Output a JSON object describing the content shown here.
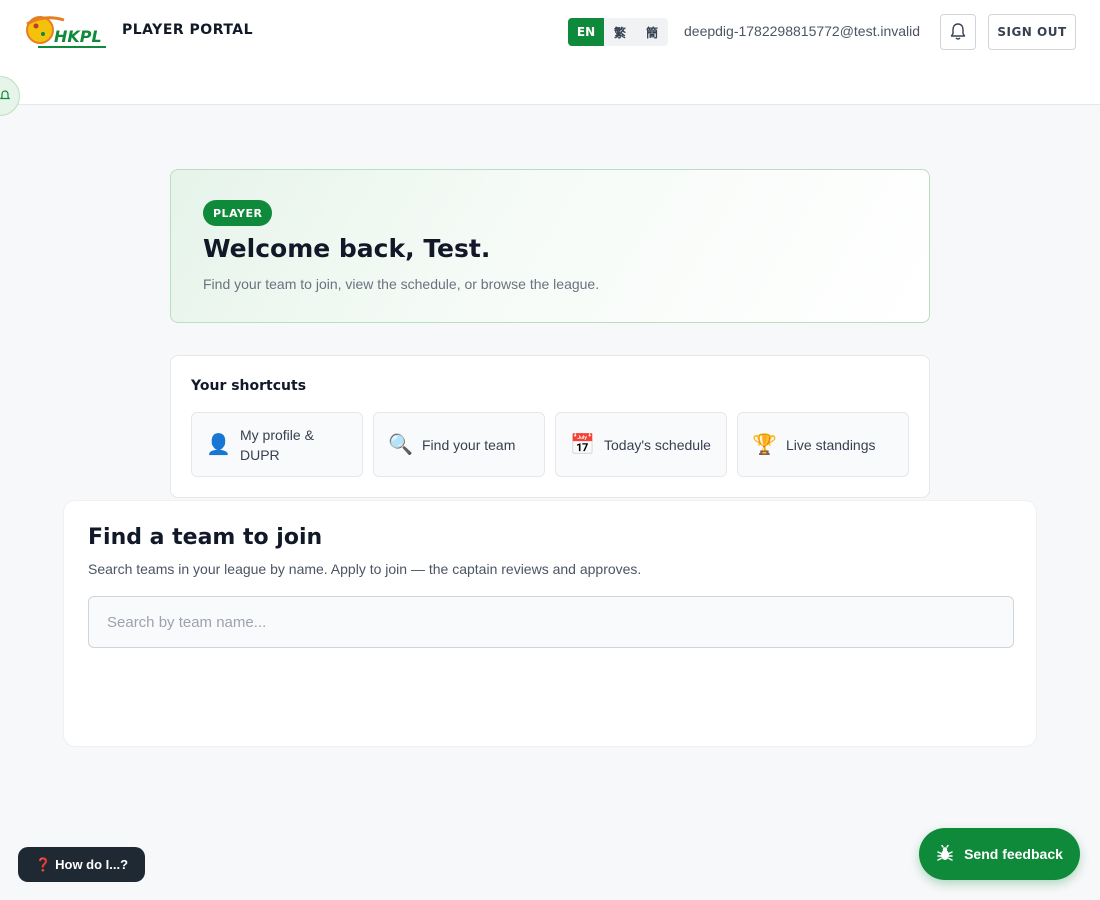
{
  "header": {
    "portal_title": "PLAYER PORTAL",
    "languages": [
      {
        "code": "EN",
        "active": true
      },
      {
        "code": "繁",
        "active": false
      },
      {
        "code": "簡",
        "active": false
      }
    ],
    "user_email": "deepdig-1782298815772@test.invalid",
    "sign_out_label": "SIGN OUT",
    "logo_text": "HKPL",
    "bell_icon": "bell-icon"
  },
  "welcome": {
    "badge": "PLAYER",
    "title": "Welcome back, Test.",
    "subtitle": "Find your team to join, view the schedule, or browse the league."
  },
  "shortcuts": {
    "title": "Your shortcuts",
    "items": [
      {
        "icon": "👤",
        "icon_name": "user-icon",
        "label": "My profile & DUPR"
      },
      {
        "icon": "🔍",
        "icon_name": "search-icon",
        "label": "Find your team"
      },
      {
        "icon": "📅",
        "icon_name": "calendar-icon",
        "label": "Today's schedule"
      },
      {
        "icon": "🏆",
        "icon_name": "trophy-icon",
        "label": "Live standings"
      }
    ]
  },
  "find_team": {
    "title": "Find a team to join",
    "subtitle": "Search teams in your league by name. Apply to join — the captain reviews and approves.",
    "search_placeholder": "Search by team name...",
    "search_value": ""
  },
  "floating": {
    "help_label": "How do I...?",
    "help_icon": "❓",
    "feedback_label": "Send feedback",
    "feedback_icon": "bug-icon"
  },
  "colors": {
    "accent": "#0f8a3a",
    "background": "#f7f8fa",
    "help_bg": "#1f2933"
  }
}
